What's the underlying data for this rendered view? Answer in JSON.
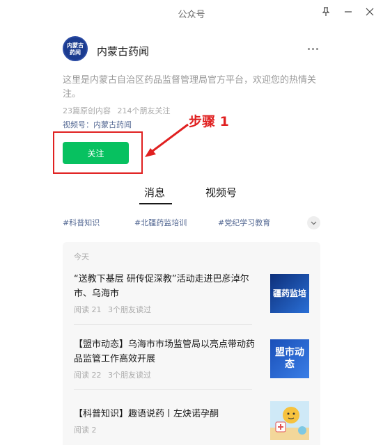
{
  "window": {
    "title": "公众号"
  },
  "account": {
    "avatar_lines": [
      "内蒙古",
      "药闻"
    ],
    "name": "内蒙古药闻",
    "description": "这里是内蒙古自治区药品监督管理局官方平台，欢迎您的热情关注。",
    "original_count": "23篇原创内容",
    "friends_following": "214个朋友关注",
    "video_channel": "视频号：内蒙古药闻",
    "follow_label": "关注"
  },
  "annotation": {
    "step_label": "步骤 1",
    "color": "#e02020"
  },
  "tabs": [
    {
      "label": "消息",
      "active": true
    },
    {
      "label": "视频号",
      "active": false
    }
  ],
  "tags": [
    "#科普知识",
    "#北疆药监培训",
    "#党纪学习教育"
  ],
  "feed": {
    "day_label": "今天",
    "articles": [
      {
        "title": "“送教下基层 研传促深教”活动走进巴彦淖尔市、乌海市",
        "reads": "阅读 21",
        "friends_read": "3个朋友读过",
        "thumb_text": "疆药监培"
      },
      {
        "title": "【盟市动态】乌海市市场监管局以亮点带动药品监管工作高效开展",
        "reads": "阅读 22",
        "friends_read": "3个朋友读过",
        "thumb_text": "盟市动态"
      },
      {
        "title": "【科普知识】趣语说药丨左炔诺孕酮",
        "reads": "阅读 2",
        "friends_read": "",
        "thumb_text": ""
      }
    ]
  },
  "colors": {
    "accent_green": "#07c160",
    "link_blue": "#576b95",
    "annotation_red": "#e02020"
  },
  "icons": [
    "pin-icon",
    "minimize-icon",
    "close-icon",
    "more-icon",
    "chevron-down-icon"
  ]
}
